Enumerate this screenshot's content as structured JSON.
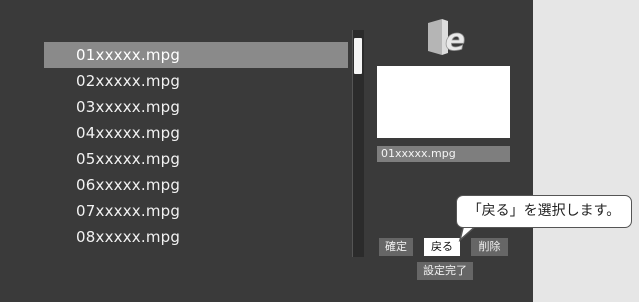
{
  "files": [
    {
      "name": "01xxxxx.mpg",
      "selected": true
    },
    {
      "name": "02xxxxx.mpg",
      "selected": false
    },
    {
      "name": "03xxxxx.mpg",
      "selected": false
    },
    {
      "name": "04xxxxx.mpg",
      "selected": false
    },
    {
      "name": "05xxxxx.mpg",
      "selected": false
    },
    {
      "name": "06xxxxx.mpg",
      "selected": false
    },
    {
      "name": "07xxxxx.mpg",
      "selected": false
    },
    {
      "name": "08xxxxx.mpg",
      "selected": false
    }
  ],
  "preview": {
    "filename": "01xxxxx.mpg"
  },
  "buttons": {
    "confirm": "確定",
    "back": "戻る",
    "delete": "削除",
    "done": "設定完了"
  },
  "callout": "「戻る」を選択します。",
  "colors": {
    "screen": "#3a3a3a",
    "selected_row": "#8a8a8a",
    "button": "#666666",
    "button_active": "#ffffff"
  },
  "icons": {
    "logo": "e-logo-icon"
  }
}
